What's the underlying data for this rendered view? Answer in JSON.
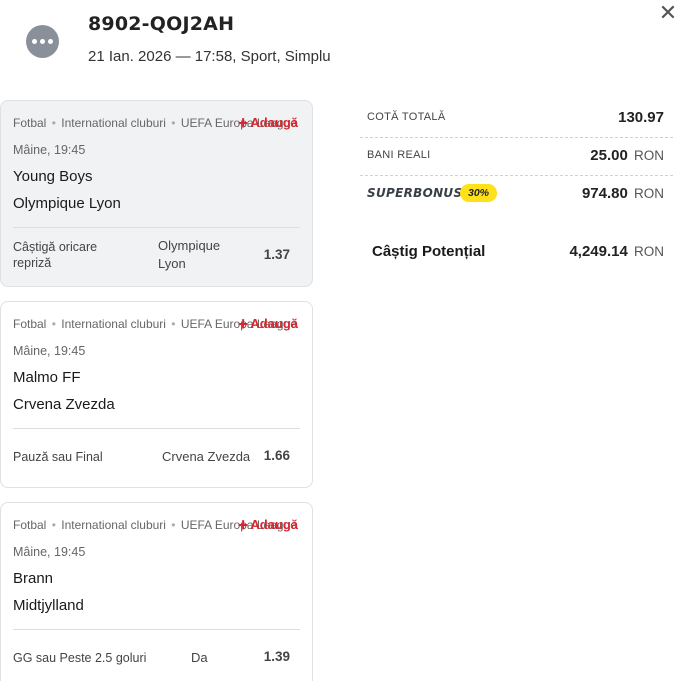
{
  "header": {
    "ticket_id": "8902-QOJ2AH",
    "meta": "21 Ian. 2026 — 17:58, Sport, Simplu",
    "menu_icon": "more-dots-icon",
    "close_icon": "close-icon",
    "close_glyph": "✕"
  },
  "bets": [
    {
      "sport": "Fotbal",
      "category": "International cluburi",
      "competition": "UEFA Europa League",
      "add_label": "Adaugă",
      "time": "Mâine, 19:45",
      "home": "Young Boys",
      "away": "Olympique Lyon",
      "market": "Câștigă oricare repriză",
      "selection": "Olympique Lyon",
      "odd": "1.37",
      "active": true
    },
    {
      "sport": "Fotbal",
      "category": "International cluburi",
      "competition": "UEFA Europa League",
      "add_label": "Adaugă",
      "time": "Mâine, 19:45",
      "home": "Malmo FF",
      "away": "Crvena Zvezda",
      "market": "Pauză sau Final",
      "selection": "Crvena Zvezda",
      "odd": "1.66",
      "active": false
    },
    {
      "sport": "Fotbal",
      "category": "International cluburi",
      "competition": "UEFA Europa League",
      "add_label": "Adaugă",
      "time": "Mâine, 19:45",
      "home": "Brann",
      "away": "Midtjylland",
      "market": "GG sau Peste 2.5 goluri",
      "selection": "Da",
      "odd": "1.39",
      "active": false
    }
  ],
  "summary": {
    "total_odds_label": "COTĂ TOTALĂ",
    "total_odds": "130.97",
    "stake_label": "BANI REALI",
    "stake": "25.00",
    "currency": "RON",
    "bonus_label": "SUPERBONUS",
    "bonus_pct": "30%",
    "bonus_amount": "974.80",
    "potential_label": "Câștig Potențial",
    "potential": "4,249.14"
  },
  "colors": {
    "accent_red": "#d8262f",
    "bonus_yellow": "#ffe11a",
    "active_card_bg": "#f1f2f4"
  }
}
